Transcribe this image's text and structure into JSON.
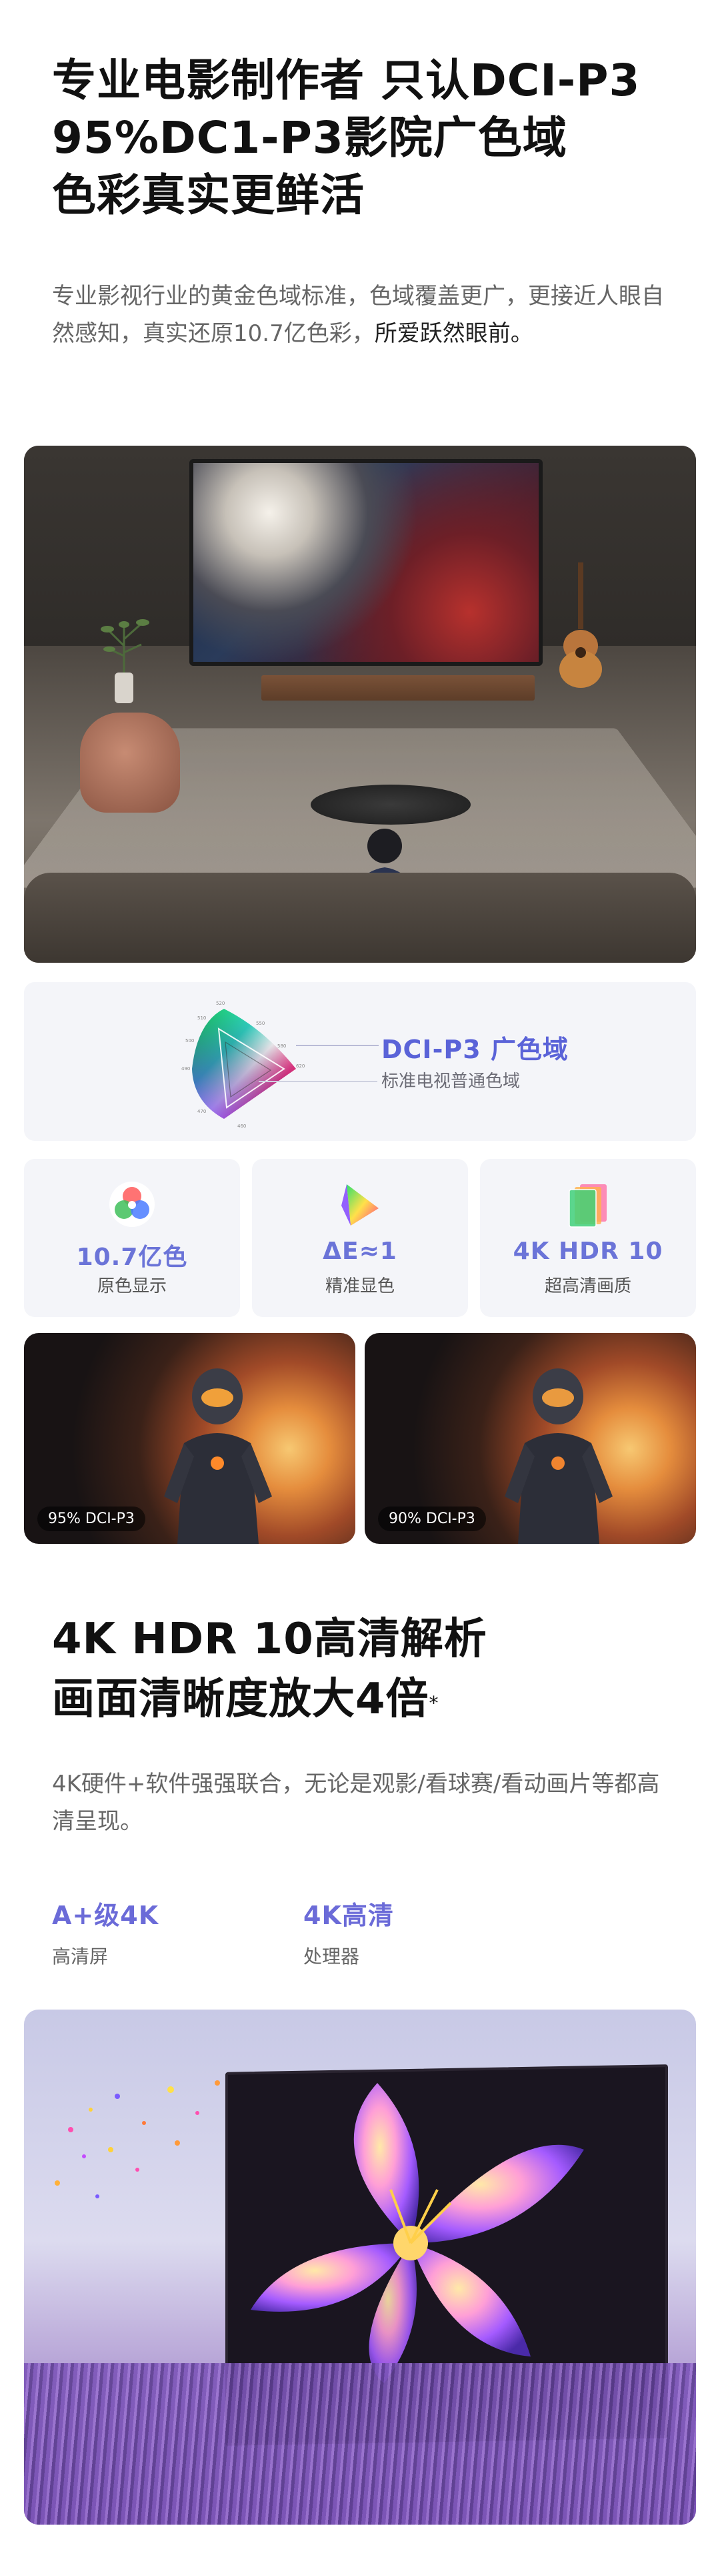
{
  "section1": {
    "headline_lines": [
      "专业电影制作者 只认DCI-P3",
      "95%DC1-P3影院广色域",
      "色彩真实更鲜活"
    ],
    "description_main": "专业影视行业的黄金色域标准，色域覆盖更广，更接近人眼自然感知，真实还原10.7亿色彩，",
    "description_dark": "所爱跃然眼前。"
  },
  "gamut": {
    "label_primary": "DCI-P3 广色域",
    "label_secondary": "标准电视普通色域"
  },
  "features": [
    {
      "value": "10.7亿色",
      "sub": "原色显示",
      "icon": "color-wheel-icon"
    },
    {
      "value": "ΔE≈1",
      "sub": "精准显色",
      "icon": "prism-triangle-icon"
    },
    {
      "value": "4K HDR 10",
      "sub": "超高清画质",
      "icon": "layered-panels-icon"
    }
  ],
  "compare": [
    {
      "badge": "95% DCI-P3"
    },
    {
      "badge": "90% DCI-P3"
    }
  ],
  "section2": {
    "headline_lines": [
      "4K HDR 10高清解析",
      "画面清晰度放大4倍"
    ],
    "headline_mark": "*",
    "description": "4K硬件+软件强强联合，无论是观影/看球赛/看动画片等都高清呈现。",
    "stats": [
      {
        "value": "A+级4K",
        "sub": "高清屏"
      },
      {
        "value": "4K高清",
        "sub": "处理器"
      }
    ]
  },
  "colors": {
    "accent": "#6b74d8",
    "accent_strong": "#5a63d8",
    "card_bg": "#f4f5f9"
  }
}
